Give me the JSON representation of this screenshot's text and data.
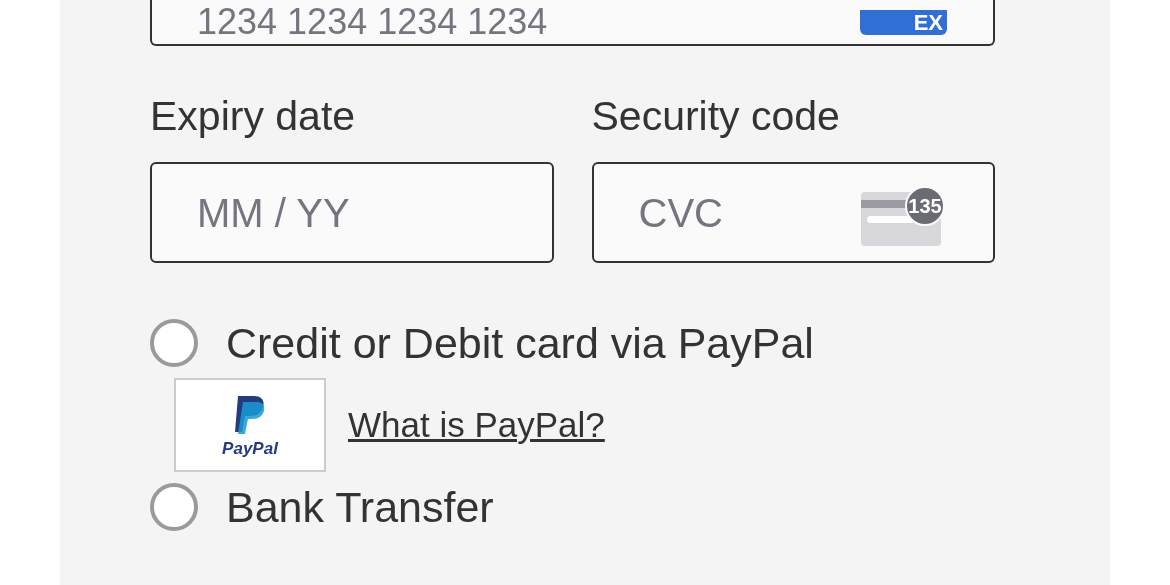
{
  "card_number": {
    "placeholder": "1234 1234 1234 1234",
    "brand_badge": "EX"
  },
  "fields": [
    {
      "label": "Expiry date",
      "placeholder": "MM / YY"
    },
    {
      "label": "Security code",
      "placeholder": "CVC",
      "badge": "135"
    }
  ],
  "payment_methods": [
    {
      "label": "Credit or Debit card via PayPal",
      "selected": false,
      "logo_text": "PayPal",
      "link": "What is PayPal?"
    },
    {
      "label": "Bank Transfer",
      "selected": false
    }
  ]
}
